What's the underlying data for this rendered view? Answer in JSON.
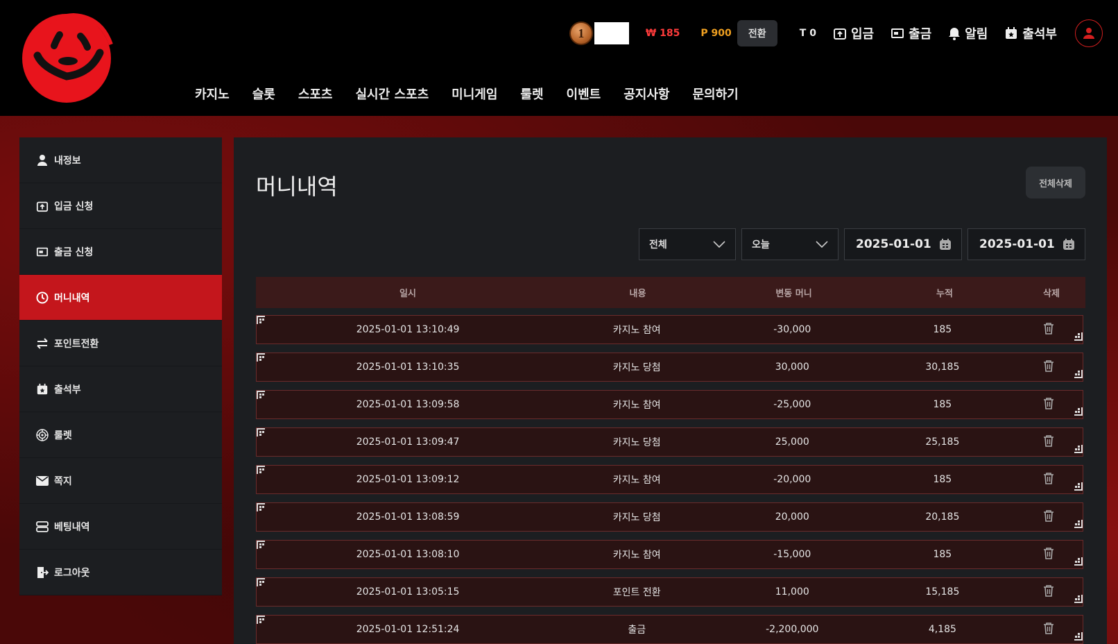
{
  "header": {
    "rank_level": "1",
    "money": "₩ 185",
    "point": "P 900",
    "convert_label": "전환",
    "t_value": "T 0",
    "links": [
      "입금",
      "출금",
      "알림",
      "출석부"
    ]
  },
  "mainnav": [
    "카지노",
    "슬롯",
    "스포츠",
    "실시간 스포츠",
    "미니게임",
    "룰렛",
    "이벤트",
    "공지사항",
    "문의하기"
  ],
  "sidebar": {
    "items": [
      {
        "label": "내정보",
        "icon": "user-icon"
      },
      {
        "label": "입금 신청",
        "icon": "deposit-icon"
      },
      {
        "label": "출금 신청",
        "icon": "withdraw-icon"
      },
      {
        "label": "머니내역",
        "icon": "clock-icon",
        "active": true
      },
      {
        "label": "포인트전환",
        "icon": "exchange-icon"
      },
      {
        "label": "출석부",
        "icon": "calendar-icon"
      },
      {
        "label": "룰렛",
        "icon": "roulette-icon"
      },
      {
        "label": "쪽지",
        "icon": "mail-icon"
      },
      {
        "label": "베팅내역",
        "icon": "list-icon"
      },
      {
        "label": "로그아웃",
        "icon": "logout-icon"
      }
    ]
  },
  "main": {
    "title": "머니내역",
    "delete_all_label": "전체삭제",
    "filter_type": "전체",
    "filter_period": "오늘",
    "date_from": "2025-01-01",
    "date_to": "2025-01-01",
    "columns": [
      "일시",
      "내용",
      "변동 머니",
      "누적",
      "삭제"
    ],
    "rows": [
      {
        "date": "2025-01-01 13:10:49",
        "desc": "카지노 참여",
        "amount": "-30,000",
        "total": "185"
      },
      {
        "date": "2025-01-01 13:10:35",
        "desc": "카지노 당첨",
        "amount": "30,000",
        "total": "30,185"
      },
      {
        "date": "2025-01-01 13:09:58",
        "desc": "카지노 참여",
        "amount": "-25,000",
        "total": "185"
      },
      {
        "date": "2025-01-01 13:09:47",
        "desc": "카지노 당첨",
        "amount": "25,000",
        "total": "25,185"
      },
      {
        "date": "2025-01-01 13:09:12",
        "desc": "카지노 참여",
        "amount": "-20,000",
        "total": "185"
      },
      {
        "date": "2025-01-01 13:08:59",
        "desc": "카지노 당첨",
        "amount": "20,000",
        "total": "20,185"
      },
      {
        "date": "2025-01-01 13:08:10",
        "desc": "카지노 참여",
        "amount": "-15,000",
        "total": "185"
      },
      {
        "date": "2025-01-01 13:05:15",
        "desc": "포인트 전환",
        "amount": "11,000",
        "total": "15,185"
      },
      {
        "date": "2025-01-01 12:51:24",
        "desc": "출금",
        "amount": "-2,200,000",
        "total": "4,185"
      }
    ]
  },
  "colors": {
    "accent": "#c4161c",
    "money": "#ff3b3b",
    "point": "#f0a020"
  }
}
